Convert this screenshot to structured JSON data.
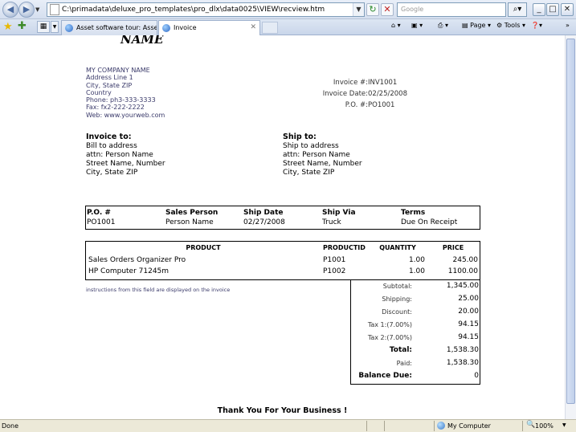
{
  "browser": {
    "url": "C:\\primadata\\deluxe_pro_templates\\pro_dlx\\data0025\\VIEW\\recview.htm",
    "search_placeholder": "Google",
    "tabs": [
      {
        "title": "Asset software tour: Asset S..."
      },
      {
        "title": "Invoice"
      }
    ],
    "commands": {
      "page": "Page",
      "tools": "Tools"
    },
    "status": {
      "text": "Done",
      "zone": "My Computer",
      "zoom": "100%"
    }
  },
  "invoice": {
    "company_name_heading": "NAME",
    "company": {
      "name": "MY COMPANY NAME",
      "address1": "Address Line 1",
      "city": "City, State ZIP",
      "country": "Country",
      "phone": "Phone: ph3-333-3333",
      "fax": "Fax: fx2-222-2222",
      "web": "Web: www.yourweb.com"
    },
    "meta": [
      {
        "label": "Invoice #:",
        "value": "INV1001"
      },
      {
        "label": "Invoice Date:",
        "value": "02/25/2008"
      },
      {
        "label": "P.O. #:",
        "value": "PO1001"
      }
    ],
    "invoice_to": {
      "title": "Invoice to:",
      "lines": [
        "Bill to address",
        "attn: Person Name",
        "Street Name, Number",
        "City, State ZIP"
      ]
    },
    "ship_to": {
      "title": "Ship to:",
      "lines": [
        "Ship to address",
        "attn: Person Name",
        "Street Name, Number",
        "City, State ZIP"
      ]
    },
    "order": {
      "headers": [
        "P.O. #",
        "Sales Person",
        "Ship Date",
        "Ship Via",
        "Terms"
      ],
      "row": [
        "PO1001",
        "Person Name",
        "02/27/2008",
        "Truck",
        "Due On Receipt"
      ]
    },
    "products": {
      "headers": [
        "PRODUCT",
        "PRODUCTID",
        "QUANTITY",
        "PRICE"
      ],
      "rows": [
        [
          "Sales Orders Organizer Pro",
          "P1001",
          "1.00",
          "245.00"
        ],
        [
          "HP Computer 71245m",
          "P1002",
          "1.00",
          "1100.00"
        ]
      ]
    },
    "instructions": "instructions from this field are displayed on the invoice",
    "totals": [
      {
        "label": "Subtotal:",
        "value": "1,345.00"
      },
      {
        "label": "Shipping:",
        "value": "25.00"
      },
      {
        "label": "Discount:",
        "value": "20.00"
      },
      {
        "label": "Tax 1:(7.00%)",
        "value": "94.15"
      },
      {
        "label": "Tax 2:(7.00%)",
        "value": "94.15"
      },
      {
        "label": "Total:",
        "value": "1,538.30"
      },
      {
        "label": "Paid:",
        "value": "1,538.30"
      },
      {
        "label": "Balance Due:",
        "value": "0"
      }
    ],
    "thank_you": "Thank You For Your Business !"
  }
}
